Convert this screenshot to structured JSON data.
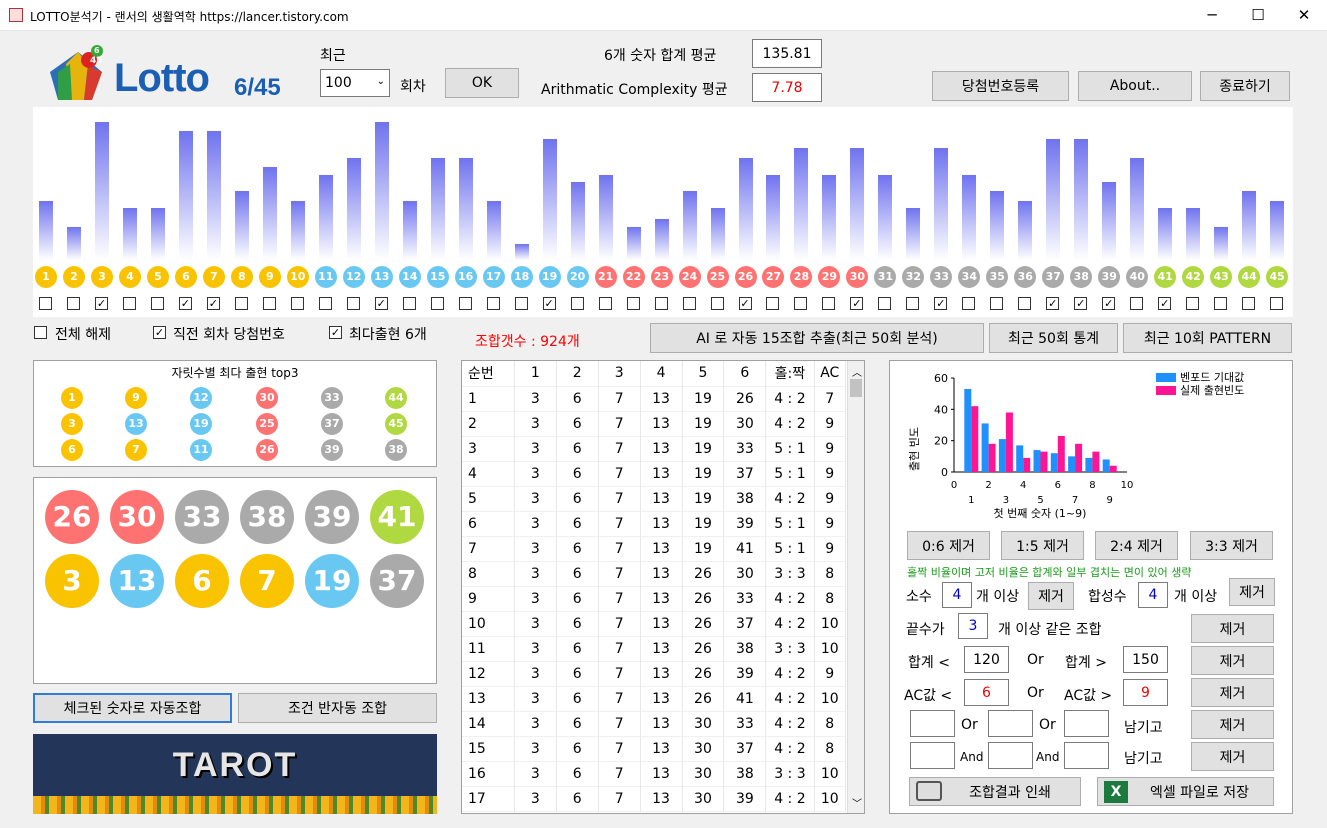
{
  "window": {
    "title": "LOTTO분석기  -  랜서의 생활역학 https://lancer.tistory.com",
    "minimize": "─",
    "maximize": "☐",
    "close": "✕"
  },
  "logo": {
    "text": "Lotto",
    "sub": "6/45",
    "badge_a": "45",
    "badge_b": "6"
  },
  "recent": {
    "label": "최근",
    "value": "100",
    "unit": "회차",
    "ok": "OK"
  },
  "stats": {
    "sum_label": "6개 숫자 합계 평균",
    "sum_value": "135.81",
    "ac_label": "Arithmatic Complexity 평균",
    "ac_value": "7.78"
  },
  "top_buttons": {
    "register": "당첨번호등록",
    "about": "About..",
    "exit": "종료하기"
  },
  "colors": {
    "yellow": "#f9c300",
    "blue": "#69c8f2",
    "red": "#ff7272",
    "gray": "#aaaaaa",
    "green": "#b0d840",
    "bar_top": "#6f73ee"
  },
  "number_bars": [
    {
      "n": "1",
      "v": 34,
      "c": false
    },
    {
      "n": "2",
      "v": 19,
      "c": false
    },
    {
      "n": "3",
      "v": 80,
      "c": true
    },
    {
      "n": "4",
      "v": 30,
      "c": false
    },
    {
      "n": "5",
      "v": 30,
      "c": false
    },
    {
      "n": "6",
      "v": 75,
      "c": true
    },
    {
      "n": "7",
      "v": 75,
      "c": true
    },
    {
      "n": "8",
      "v": 40,
      "c": false
    },
    {
      "n": "9",
      "v": 54,
      "c": false
    },
    {
      "n": "10",
      "v": 34,
      "c": false
    },
    {
      "n": "11",
      "v": 49,
      "c": false
    },
    {
      "n": "12",
      "v": 59,
      "c": false
    },
    {
      "n": "13",
      "v": 80,
      "c": true
    },
    {
      "n": "14",
      "v": 34,
      "c": false
    },
    {
      "n": "15",
      "v": 59,
      "c": false
    },
    {
      "n": "16",
      "v": 59,
      "c": false
    },
    {
      "n": "17",
      "v": 34,
      "c": false
    },
    {
      "n": "18",
      "v": 9,
      "c": false
    },
    {
      "n": "19",
      "v": 70,
      "c": true
    },
    {
      "n": "20",
      "v": 45,
      "c": false
    },
    {
      "n": "21",
      "v": 49,
      "c": false
    },
    {
      "n": "22",
      "v": 19,
      "c": false
    },
    {
      "n": "23",
      "v": 24,
      "c": false
    },
    {
      "n": "24",
      "v": 40,
      "c": false
    },
    {
      "n": "25",
      "v": 30,
      "c": false
    },
    {
      "n": "26",
      "v": 59,
      "c": true
    },
    {
      "n": "27",
      "v": 49,
      "c": false
    },
    {
      "n": "28",
      "v": 65,
      "c": false
    },
    {
      "n": "29",
      "v": 49,
      "c": false
    },
    {
      "n": "30",
      "v": 65,
      "c": true
    },
    {
      "n": "31",
      "v": 49,
      "c": false
    },
    {
      "n": "32",
      "v": 30,
      "c": false
    },
    {
      "n": "33",
      "v": 65,
      "c": true
    },
    {
      "n": "34",
      "v": 49,
      "c": false
    },
    {
      "n": "35",
      "v": 40,
      "c": false
    },
    {
      "n": "36",
      "v": 34,
      "c": false
    },
    {
      "n": "37",
      "v": 70,
      "c": true
    },
    {
      "n": "38",
      "v": 70,
      "c": true
    },
    {
      "n": "39",
      "v": 45,
      "c": true
    },
    {
      "n": "40",
      "v": 59,
      "c": false
    },
    {
      "n": "41",
      "v": 30,
      "c": true
    },
    {
      "n": "42",
      "v": 30,
      "c": false
    },
    {
      "n": "43",
      "v": 19,
      "c": false
    },
    {
      "n": "44",
      "v": 40,
      "c": false
    },
    {
      "n": "45",
      "v": 34,
      "c": false
    }
  ],
  "checks": {
    "clear_all": "전체 해제",
    "prev_win": "직전 회차 당첨번호",
    "max6": "최다출현 6개"
  },
  "combo_count": "조합갯수 : 924개",
  "mid_buttons": {
    "ai15": "AI 로 자동 15조합 추출(최근 50회 분석)",
    "stats50": "최근 50회 통계",
    "pattern10": "최근 10회 PATTERN"
  },
  "top3": {
    "title": "자릿수별 최다 출현 top3",
    "rows": [
      [
        "1",
        "9",
        "12",
        "30",
        "33",
        "44"
      ],
      [
        "3",
        "13",
        "19",
        "25",
        "37",
        "45"
      ],
      [
        "6",
        "7",
        "11",
        "26",
        "39",
        "38"
      ]
    ]
  },
  "big_balls": [
    [
      "26",
      "30",
      "33",
      "38",
      "39",
      "41"
    ],
    [
      "3",
      "13",
      "6",
      "7",
      "19",
      "37"
    ]
  ],
  "bottom_buttons": {
    "auto": "체크된 숫자로 자동조합",
    "semi": "조건 반자동 조합"
  },
  "banner": "TAROT",
  "table": {
    "headers": [
      "순번",
      "1",
      "2",
      "3",
      "4",
      "5",
      "6",
      "홀:짝",
      "AC"
    ],
    "rows": [
      [
        "1",
        "3",
        "6",
        "7",
        "13",
        "19",
        "26",
        "4 : 2",
        "7"
      ],
      [
        "2",
        "3",
        "6",
        "7",
        "13",
        "19",
        "30",
        "4 : 2",
        "9"
      ],
      [
        "3",
        "3",
        "6",
        "7",
        "13",
        "19",
        "33",
        "5 : 1",
        "9"
      ],
      [
        "4",
        "3",
        "6",
        "7",
        "13",
        "19",
        "37",
        "5 : 1",
        "9"
      ],
      [
        "5",
        "3",
        "6",
        "7",
        "13",
        "19",
        "38",
        "4 : 2",
        "9"
      ],
      [
        "6",
        "3",
        "6",
        "7",
        "13",
        "19",
        "39",
        "5 : 1",
        "9"
      ],
      [
        "7",
        "3",
        "6",
        "7",
        "13",
        "19",
        "41",
        "5 : 1",
        "9"
      ],
      [
        "8",
        "3",
        "6",
        "7",
        "13",
        "26",
        "30",
        "3 : 3",
        "8"
      ],
      [
        "9",
        "3",
        "6",
        "7",
        "13",
        "26",
        "33",
        "4 : 2",
        "8"
      ],
      [
        "10",
        "3",
        "6",
        "7",
        "13",
        "26",
        "37",
        "4 : 2",
        "10"
      ],
      [
        "11",
        "3",
        "6",
        "7",
        "13",
        "26",
        "38",
        "3 : 3",
        "10"
      ],
      [
        "12",
        "3",
        "6",
        "7",
        "13",
        "26",
        "39",
        "4 : 2",
        "9"
      ],
      [
        "13",
        "3",
        "6",
        "7",
        "13",
        "26",
        "41",
        "4 : 2",
        "10"
      ],
      [
        "14",
        "3",
        "6",
        "7",
        "13",
        "30",
        "33",
        "4 : 2",
        "8"
      ],
      [
        "15",
        "3",
        "6",
        "7",
        "13",
        "30",
        "37",
        "4 : 2",
        "8"
      ],
      [
        "16",
        "3",
        "6",
        "7",
        "13",
        "30",
        "38",
        "3 : 3",
        "10"
      ],
      [
        "17",
        "3",
        "6",
        "7",
        "13",
        "30",
        "39",
        "4 : 2",
        "10"
      ]
    ]
  },
  "chart_data": {
    "type": "bar",
    "categories": [
      "1",
      "2",
      "3",
      "4",
      "5",
      "6",
      "7",
      "8",
      "9"
    ],
    "series": [
      {
        "name": "벤포드 기대값",
        "color": "#1e90ff",
        "values": [
          53,
          31,
          21,
          17,
          14,
          12,
          10,
          9,
          8
        ]
      },
      {
        "name": "실제 출현빈도",
        "color": "#ff1493",
        "values": [
          42,
          18,
          38,
          9,
          13,
          23,
          18,
          13,
          4
        ]
      }
    ],
    "ylabel": "출현 빈도",
    "xlabel": "첫 번째 숫자 (1~9)",
    "ylim": [
      0,
      60
    ],
    "xlim": [
      0,
      10
    ],
    "yticks": [
      "0",
      "20",
      "40",
      "60"
    ],
    "xticks": [
      "0",
      "2",
      "4",
      "6",
      "8",
      "10"
    ],
    "xticks_minor": [
      "1",
      "3",
      "5",
      "7",
      "9"
    ],
    "legend": "top-right"
  },
  "filters": {
    "ratio_buttons": [
      "0:6 제거",
      "1:5 제거",
      "2:4 제거",
      "3:3 제거"
    ],
    "note": "홀짝 비율이며 고저 비율은 합계와 일부 겹치는 면이 있어 생략",
    "prime_label": "소수",
    "prime_value": "4",
    "prime_unit": "개 이상",
    "remove": "제거",
    "composite_label": "합성수",
    "composite_value": "4",
    "composite_unit": "개 이상",
    "last_label": "끝수가",
    "last_value": "3",
    "last_unit": "개 이상 같은 조합",
    "sum_lt_label": "합계 <",
    "sum_lt_value": "120",
    "or": "Or",
    "sum_gt_label": "합계 >",
    "sum_gt_value": "150",
    "ac_lt_label": "AC값 <",
    "ac_lt_value": "6",
    "ac_gt_label": "AC값 >",
    "ac_gt_value": "9",
    "or2": "Or",
    "or3": "Or",
    "keep": "남기고",
    "and1": "And",
    "and2": "And",
    "keep2": "남기고",
    "print": "조합결과 인쇄",
    "excel": "엑셀 파일로 저장"
  }
}
